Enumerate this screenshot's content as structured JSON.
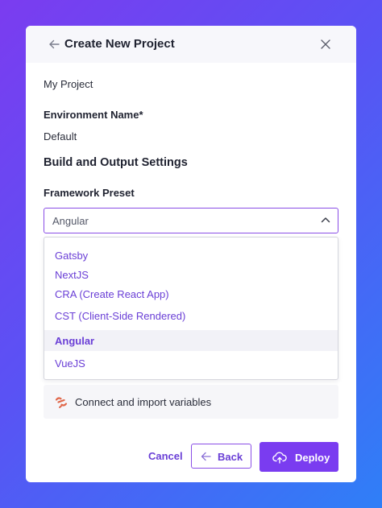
{
  "header": {
    "title": "Create New Project",
    "back_icon": "arrow-left-icon",
    "close_icon": "close-icon"
  },
  "project": {
    "name": "My Project"
  },
  "environment": {
    "label": "Environment Name*",
    "value": "Default"
  },
  "build_settings": {
    "title": "Build and Output Settings",
    "framework_label": "Framework Preset",
    "selected": "Angular",
    "options": [
      "Gatsby",
      "NextJS",
      "CRA (Create React App)",
      "CST (Client-Side Rendered)",
      "Angular",
      "VueJS"
    ]
  },
  "connect": {
    "label": "Connect and import variables",
    "icon": "link-icon"
  },
  "footer": {
    "cancel_label": "Cancel",
    "back_label": "Back",
    "deploy_label": "Deploy",
    "deploy_icon": "cloud-upload-icon"
  },
  "colors": {
    "accent": "#7a3cf0",
    "accent_text": "#6a3fd6",
    "link_icon": "#e0674a"
  }
}
